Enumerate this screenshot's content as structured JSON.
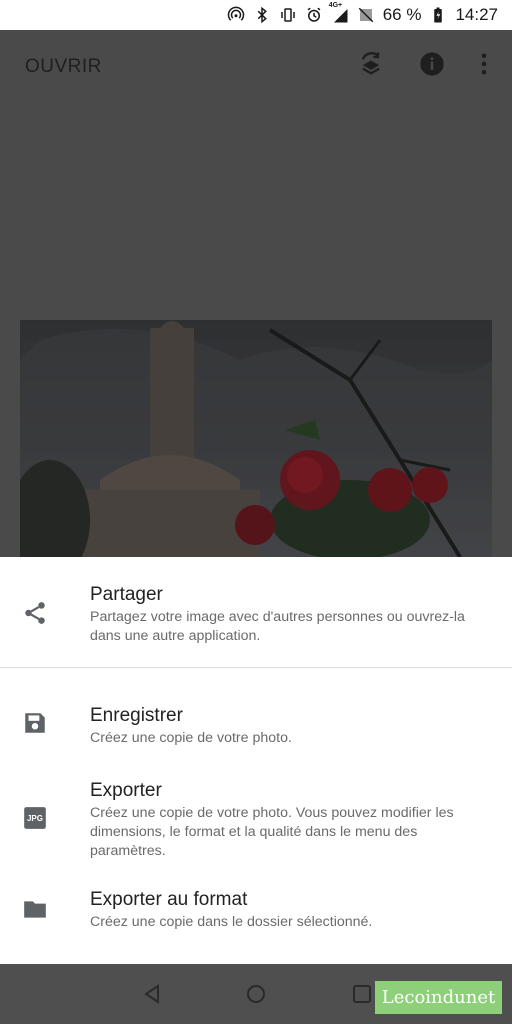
{
  "status_bar": {
    "battery": "66 %",
    "time": "14:27",
    "network": "4G+",
    "icons": [
      "hotspot-icon",
      "bluetooth-icon",
      "vibrate-icon",
      "alarm-icon",
      "signal-icon",
      "no-sim-icon",
      "battery-charging-icon"
    ]
  },
  "app_bar": {
    "open_label": "OUVRIR",
    "icons": [
      "layers-rotate-icon",
      "info-icon",
      "more-vert-icon"
    ]
  },
  "share_sheet": {
    "items": [
      {
        "icon": "share-icon",
        "title": "Partager",
        "description": "Partagez votre image avec d'autres personnes ou ouvrez-la dans une autre application."
      },
      {
        "icon": "save-icon",
        "title": "Enregistrer",
        "description": "Créez une copie de votre photo."
      },
      {
        "icon": "jpg-icon",
        "icon_text": "JPG",
        "title": "Exporter",
        "description": "Créez une copie de votre photo. Vous pouvez modifier les dimensions, le format et la qualité dans le menu des paramètres."
      },
      {
        "icon": "folder-icon",
        "title": "Exporter au format",
        "description": "Créez une copie dans le dossier sélectionné."
      }
    ]
  },
  "nav_bar": {
    "buttons": [
      "back-icon",
      "home-icon",
      "recents-icon"
    ]
  },
  "watermark": {
    "text": "Lecoindunet"
  },
  "colors": {
    "sheet_bg": "#ffffff",
    "dim_overlay": "#4a4a4a",
    "title_text": "#222222",
    "desc_text": "#6a6a6a",
    "icon_gray": "#5f6368",
    "watermark_bg": "#8ecf7a"
  }
}
